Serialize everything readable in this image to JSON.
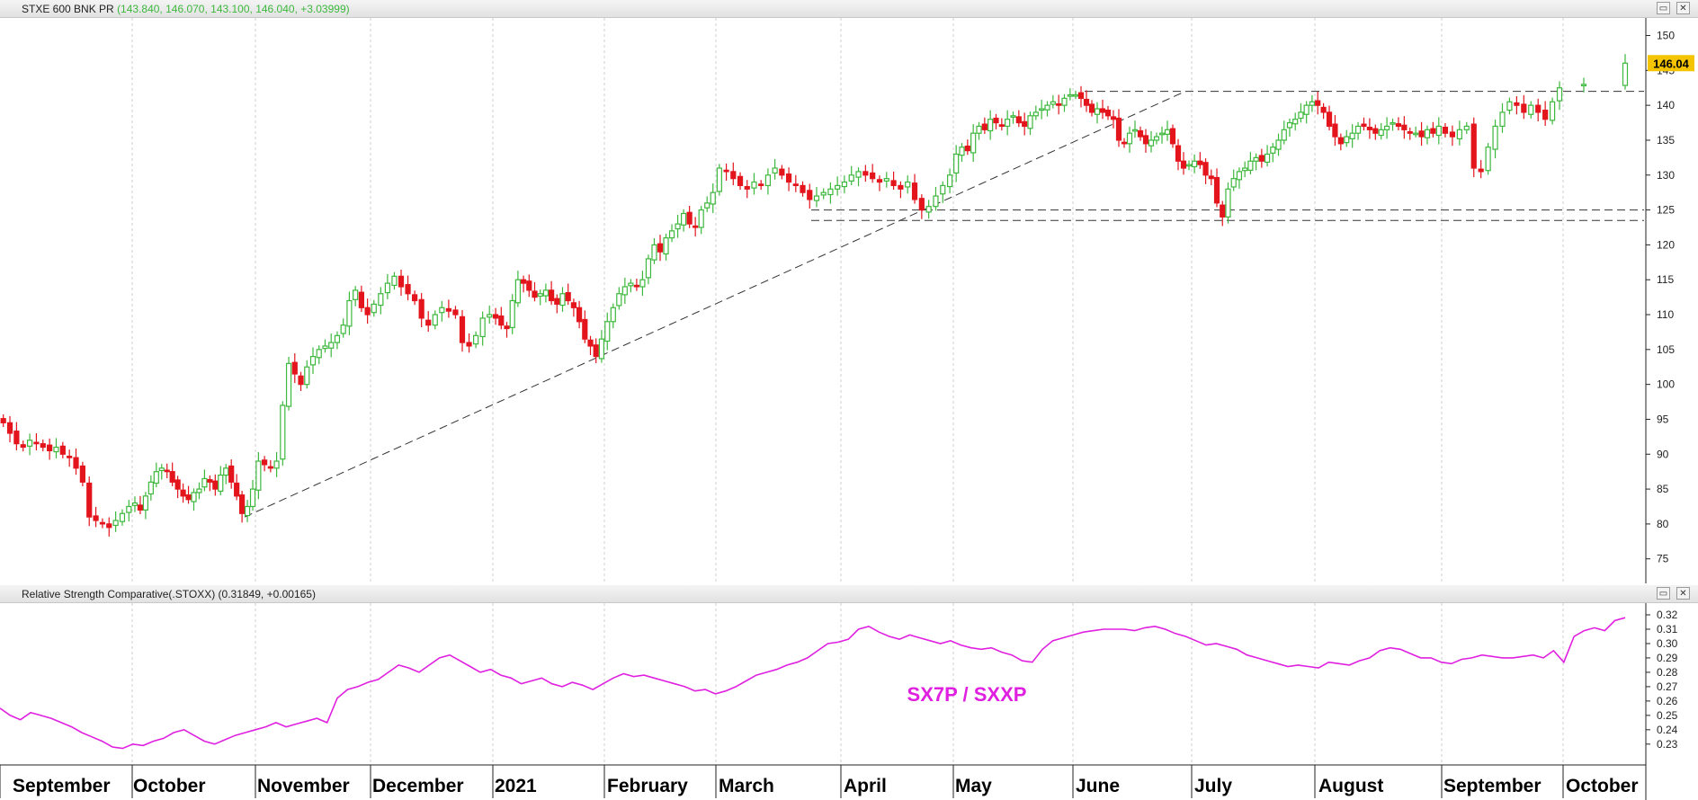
{
  "main_panel": {
    "title": "STXE 600 BNK PR",
    "values": "(143.840, 146.070, 143.100, 146.040, +3.03999)",
    "last_price_label": "146.04",
    "restore_icon": "restore-icon",
    "close_icon": "close-icon"
  },
  "rs_panel": {
    "title": "Relative Strength Comparative(.STOXX)",
    "values": "(0.31849, +0.00165)",
    "annotation": "SX7P / SXXP"
  },
  "colors": {
    "up": "#3cb83c",
    "down": "#e3141c",
    "rs_line": "#e020e0",
    "label_bg": "#f5c400"
  },
  "chart_data": [
    {
      "type": "candlestick",
      "y_axis_ticks": [
        75,
        80,
        85,
        90,
        95,
        100,
        105,
        110,
        115,
        120,
        125,
        130,
        135,
        140,
        145,
        150
      ],
      "ylim": [
        72,
        152
      ],
      "last_close": 146.04,
      "x_months": [
        "September",
        "October",
        "November",
        "December",
        "2021",
        "February",
        "March",
        "April",
        "May",
        "June",
        "July",
        "August",
        "September",
        "October"
      ],
      "approx_closes_by_month": [
        [
          94.5,
          93.0,
          91.5,
          91.0,
          92.0,
          91.5,
          91.0,
          90.5,
          91.0,
          90.0,
          89.5,
          88.0,
          86.0,
          81.0,
          80.5,
          80.0,
          79.5,
          80.5,
          81.5,
          82.5
        ],
        [
          83.0,
          82.0,
          84.0,
          86.0,
          87.5,
          88.0,
          87.5,
          86.0,
          85.0,
          84.0,
          83.5,
          84.5,
          85.0,
          86.5,
          86.0,
          85.0,
          87.0,
          88.0,
          86.0,
          84.0,
          81.5,
          82.5,
          85.0
        ],
        [
          89.0,
          88.5,
          88.0,
          89.0,
          97.0,
          103.0,
          101.5,
          100.0,
          102.5,
          104.0,
          105.0,
          105.5,
          106.0,
          107.0,
          108.5,
          112.0,
          113.5,
          111.0,
          110.0
        ],
        [
          111.5,
          113.0,
          114.5,
          115.5,
          114.0,
          113.0,
          112.0,
          109.5,
          108.5,
          110.0,
          111.0,
          110.5,
          110.0,
          106.0,
          105.5,
          107.0,
          109.5,
          110.0
        ],
        [
          109.5,
          108.5,
          108.0,
          112.0,
          115.0,
          114.5,
          113.5,
          112.5,
          113.0,
          113.5,
          112.0,
          111.5,
          113.0,
          112.0,
          111.0,
          109.0,
          106.5,
          105.5,
          104.0,
          106.5
        ],
        [
          109.0,
          111.0,
          113.0,
          114.0,
          114.5,
          114.0,
          115.0,
          118.0,
          120.0,
          119.0,
          121.0,
          122.0,
          123.0,
          124.5,
          123.0,
          122.5,
          125.0,
          126.0,
          127.5
        ],
        [
          131.0,
          130.5,
          129.5,
          128.5,
          128.0,
          129.0,
          128.5,
          130.0,
          131.0,
          130.0,
          129.0,
          128.5,
          127.5,
          126.5,
          127.0,
          127.5,
          128.0,
          128.5
        ],
        [
          129.0,
          130.0,
          130.5,
          130.0,
          129.5,
          129.0,
          129.5,
          128.5,
          128.0,
          129.0,
          126.5,
          125.0,
          125.5,
          127.0,
          128.5,
          130.0
        ],
        [
          133.0,
          134.0,
          133.5,
          136.0,
          137.0,
          136.5,
          138.0,
          137.5,
          137.0,
          138.0,
          138.5,
          137.5,
          137.0,
          138.5,
          139.0,
          139.5,
          140.0,
          140.5,
          140.0,
          141.0,
          141.5
        ],
        [
          141.5,
          141.0,
          140.0,
          139.0,
          139.5,
          139.0,
          138.5,
          138.0,
          135.0,
          134.5,
          136.0,
          136.5,
          135.5,
          134.5,
          135.0,
          135.5,
          136.0,
          136.5,
          134.5,
          132.0,
          131.0,
          131.5
        ],
        [
          132.0,
          131.5,
          130.0,
          129.5,
          126.0,
          124.0,
          128.0,
          129.5,
          130.5,
          131.0,
          132.0,
          132.5,
          132.0,
          133.0,
          134.0,
          135.0,
          136.5,
          137.5,
          138.0,
          139.0,
          140.0,
          140.5
        ],
        [
          140.0,
          139.0,
          137.0,
          135.5,
          134.5,
          135.5,
          136.0,
          137.0,
          137.0,
          136.5,
          136.0,
          136.5,
          137.0,
          137.5,
          137.0,
          136.5,
          136.0,
          136.0,
          135.5,
          136.5,
          136.0,
          137.0
        ],
        [
          136.0,
          135.5,
          136.5,
          137.0,
          131.0,
          130.5,
          134.0,
          137.0,
          139.0,
          140.5,
          140.0,
          139.0,
          140.0,
          139.0,
          138.0,
          140.5,
          142.5
        ],
        [
          143.0,
          146.04
        ]
      ],
      "trendlines": [
        {
          "style": "dashed",
          "from": {
            "date": "late October",
            "value": 81
          },
          "to": {
            "date": "mid June",
            "value": 142
          }
        },
        {
          "style": "dashed",
          "from": {
            "date": "early June",
            "value": 142
          },
          "to": {
            "date": "early October",
            "value": 142
          }
        },
        {
          "style": "dashed",
          "from": {
            "date": "mid March",
            "value": 125
          },
          "to": {
            "date": "early October",
            "value": 125
          }
        },
        {
          "style": "dashed",
          "from": {
            "date": "mid March",
            "value": 123.5
          },
          "to": {
            "date": "early October",
            "value": 123.5
          }
        }
      ]
    },
    {
      "type": "line",
      "series": [
        {
          "name": "SX7P / SXXP",
          "values": [
            0.255,
            0.25,
            0.247,
            0.252,
            0.25,
            0.248,
            0.245,
            0.242,
            0.238,
            0.235,
            0.232,
            0.228,
            0.227,
            0.23,
            0.229,
            0.232,
            0.234,
            0.238,
            0.24,
            0.236,
            0.232,
            0.23,
            0.233,
            0.236,
            0.238,
            0.24,
            0.242,
            0.245,
            0.242,
            0.244,
            0.246,
            0.248,
            0.245,
            0.262,
            0.268,
            0.27,
            0.273,
            0.275,
            0.28,
            0.285,
            0.283,
            0.28,
            0.285,
            0.29,
            0.292,
            0.288,
            0.284,
            0.28,
            0.282,
            0.278,
            0.276,
            0.272,
            0.274,
            0.276,
            0.272,
            0.27,
            0.273,
            0.271,
            0.268,
            0.272,
            0.276,
            0.279,
            0.277,
            0.278,
            0.276,
            0.274,
            0.272,
            0.27,
            0.267,
            0.268,
            0.265,
            0.267,
            0.27,
            0.274,
            0.278,
            0.28,
            0.282,
            0.285,
            0.287,
            0.29,
            0.295,
            0.3,
            0.301,
            0.303,
            0.31,
            0.312,
            0.308,
            0.305,
            0.303,
            0.306,
            0.304,
            0.302,
            0.3,
            0.302,
            0.299,
            0.297,
            0.296,
            0.297,
            0.294,
            0.292,
            0.288,
            0.287,
            0.296,
            0.302,
            0.304,
            0.306,
            0.308,
            0.309,
            0.31,
            0.31,
            0.31,
            0.309,
            0.311,
            0.312,
            0.31,
            0.307,
            0.305,
            0.302,
            0.299,
            0.3,
            0.298,
            0.296,
            0.292,
            0.29,
            0.288,
            0.286,
            0.284,
            0.285,
            0.284,
            0.283,
            0.287,
            0.286,
            0.285,
            0.288,
            0.29,
            0.295,
            0.297,
            0.296,
            0.293,
            0.29,
            0.29,
            0.287,
            0.286,
            0.289,
            0.29,
            0.292,
            0.291,
            0.29,
            0.29,
            0.291,
            0.292,
            0.29,
            0.295,
            0.287,
            0.305,
            0.309,
            0.311,
            0.309,
            0.316,
            0.318
          ]
        }
      ],
      "y_axis_ticks": [
        0.23,
        0.24,
        0.25,
        0.26,
        0.27,
        0.28,
        0.29,
        0.3,
        0.31,
        0.32
      ],
      "ylim": [
        0.218,
        0.325
      ],
      "last_value": 0.31849
    }
  ]
}
